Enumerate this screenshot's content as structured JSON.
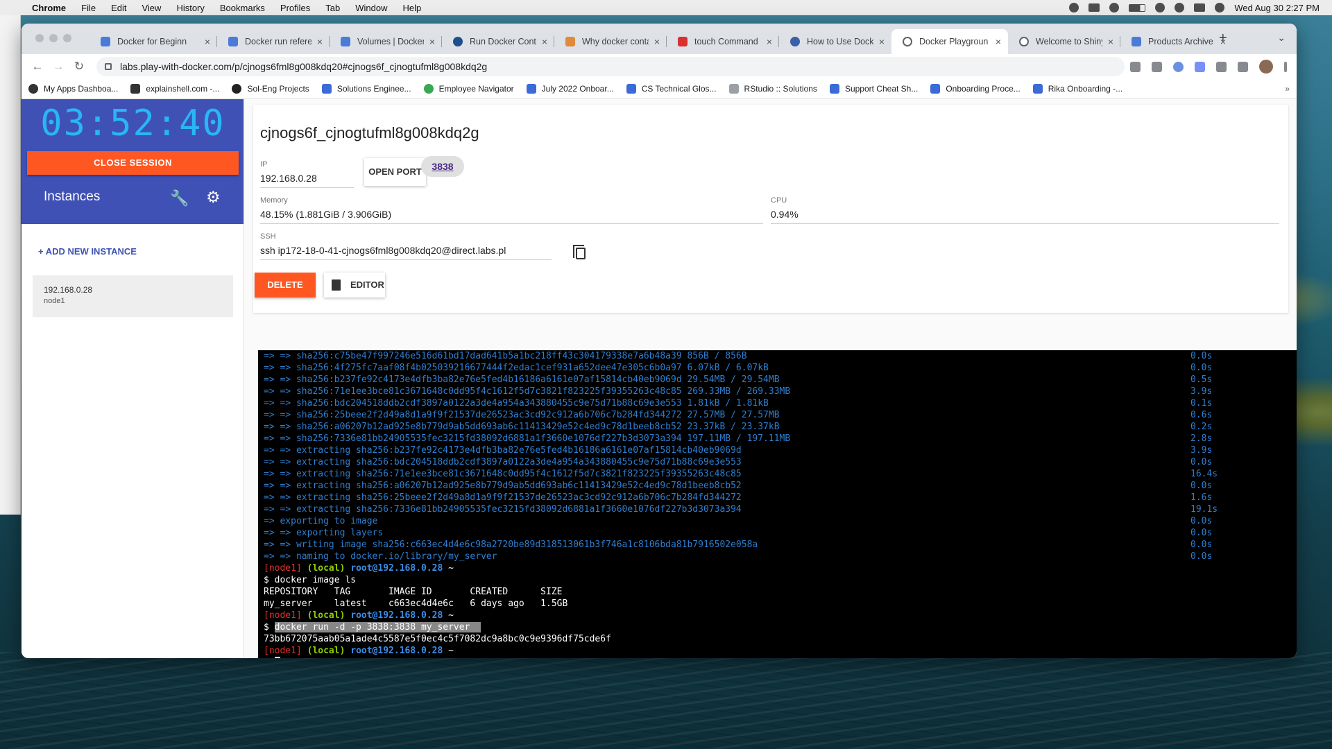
{
  "menubar": {
    "app": "Chrome",
    "items": [
      "File",
      "Edit",
      "View",
      "History",
      "Bookmarks",
      "Profiles",
      "Tab",
      "Window",
      "Help"
    ],
    "clock": "Wed Aug 30  2:27 PM"
  },
  "tabs": [
    {
      "label": "Docker for Beginn"
    },
    {
      "label": "Docker run refere"
    },
    {
      "label": "Volumes | Docker"
    },
    {
      "label": "Run Docker Conta"
    },
    {
      "label": "Why docker conta"
    },
    {
      "label": "touch Command"
    },
    {
      "label": "How to Use Dock"
    },
    {
      "label": "Docker Playgroun"
    },
    {
      "label": "Welcome to Shiny"
    },
    {
      "label": "Products Archive"
    }
  ],
  "url": "labs.play-with-docker.com/p/cjnogs6fml8g008kdq20#cjnogs6f_cjnogtufml8g008kdq2g",
  "bookmarks": [
    "My Apps Dashboa...",
    "explainshell.com -...",
    "Sol-Eng Projects",
    "Solutions Enginee...",
    "Employee Navigator",
    "July 2022 Onboar...",
    "CS Technical Glos...",
    "RStudio :: Solutions",
    "Support Cheat Sh...",
    "Onboarding Proce...",
    "Rika Onboarding -..."
  ],
  "sidebar": {
    "timer": "03:52:40",
    "close_session": "CLOSE SESSION",
    "instances_title": "Instances",
    "add_new": "+ ADD NEW INSTANCE",
    "instance": {
      "ip": "192.168.0.28",
      "name": "node1"
    }
  },
  "instance_panel": {
    "hostname": "cjnogs6f_cjnogtufml8g008kdq2g",
    "ip_label": "IP",
    "ip": "192.168.0.28",
    "open_port": "OPEN PORT",
    "port": "3838",
    "memory_label": "Memory",
    "memory": "48.15% (1.881GiB / 3.906GiB)",
    "cpu_label": "CPU",
    "cpu": "0.94%",
    "ssh_label": "SSH",
    "ssh": "ssh ip172-18-0-41-cjnogs6fml8g008kdq20@direct.labs.pl",
    "delete": "DELETE",
    "editor": "EDITOR"
  },
  "terminal": {
    "build_lines": [
      {
        "text": "=> => sha256:c75be47f997246e516d61bd17dad641b5a1bc218ff43c304179338e7a6b48a39 856B / 856B",
        "time": "0.0s"
      },
      {
        "text": "=> => sha256:4f275fc7aaf08f4b025039216677444f2edac1cef931a652dee47e305c6b0a97 6.07kB / 6.07kB",
        "time": "0.0s"
      },
      {
        "text": "=> => sha256:b237fe92c4173e4dfb3ba82e76e5fed4b16186a6161e07af15814cb40eb9069d 29.54MB / 29.54MB",
        "time": "0.5s"
      },
      {
        "text": "=> => sha256:71e1ee3bce81c3671648c0dd95f4c1612f5d7c3821f823225f39355263c48c85 269.33MB / 269.33MB",
        "time": "3.9s"
      },
      {
        "text": "=> => sha256:bdc204518ddb2cdf3897a0122a3de4a954a343880455c9e75d71b88c69e3e553 1.81kB / 1.81kB",
        "time": "0.1s"
      },
      {
        "text": "=> => sha256:25beee2f2d49a8d1a9f9f21537de26523ac3cd92c912a6b706c7b284fd344272 27.57MB / 27.57MB",
        "time": "0.6s"
      },
      {
        "text": "=> => sha256:a06207b12ad925e8b779d9ab5dd693ab6c11413429e52c4ed9c78d1beeb8cb52 23.37kB / 23.37kB",
        "time": "0.2s"
      },
      {
        "text": "=> => sha256:7336e81bb24905535fec3215fd38092d6881a1f3660e1076df227b3d3073a394 197.11MB / 197.11MB",
        "time": "2.8s"
      },
      {
        "text": "=> => extracting sha256:b237fe92c4173e4dfb3ba82e76e5fed4b16186a6161e07af15814cb40eb9069d",
        "time": "3.9s"
      },
      {
        "text": "=> => extracting sha256:bdc204518ddb2cdf3897a0122a3de4a954a343880455c9e75d71b88c69e3e553",
        "time": "0.0s"
      },
      {
        "text": "=> => extracting sha256:71e1ee3bce81c3671648c0dd95f4c1612f5d7c3821f823225f39355263c48c85",
        "time": "16.4s"
      },
      {
        "text": "=> => extracting sha256:a06207b12ad925e8b779d9ab5dd693ab6c11413429e52c4ed9c78d1beeb8cb52",
        "time": "0.0s"
      },
      {
        "text": "=> => extracting sha256:25beee2f2d49a8d1a9f9f21537de26523ac3cd92c912a6b706c7b284fd344272",
        "time": "1.6s"
      },
      {
        "text": "=> => extracting sha256:7336e81bb24905535fec3215fd38092d6881a1f3660e1076df227b3d3073a394",
        "time": "19.1s"
      },
      {
        "text": "=> exporting to image",
        "time": "0.0s"
      },
      {
        "text": "=> => exporting layers",
        "time": "0.0s"
      },
      {
        "text": "=> => writing image sha256:c663ec4d4e6c98a2720be89d318513061b3f746a1c8106bda81b7916502e058a",
        "time": "0.0s"
      },
      {
        "text": "=> => naming to docker.io/library/my_server",
        "time": "0.0s"
      }
    ],
    "prompt": {
      "node": "[node1]",
      "local": "(local)",
      "host": "root@192.168.0.28",
      "tilde": "~"
    },
    "cmd1": "$ docker image ls",
    "table_header": "REPOSITORY   TAG       IMAGE ID       CREATED      SIZE",
    "table_row": "my_server    latest    c663ec4d4e6c   6 days ago   1.5GB",
    "cmd2_prefix": "$ ",
    "cmd2": "docker run -d -p 3838:3838 my_server  ",
    "container_id": "73bb672075aab05a1ade4c5587e5f0ec4c5f7082dc9a8bc0c9e9396df75cde6f",
    "cmd3_prefix": "$ "
  }
}
